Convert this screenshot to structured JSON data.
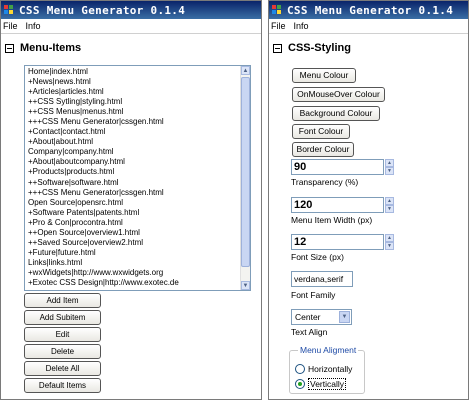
{
  "app_title": "CSS Menu Generator 0.1.4",
  "menubar": [
    "File",
    "Info"
  ],
  "left_panel": {
    "section_title": "Menu-Items",
    "items": [
      "Home|index.html",
      "+News|news.html",
      "+Articles|articles.html",
      "++CSS Sytling|styling.html",
      "++CSS Menus|menus.html",
      "+++CSS Menu Generator|cssgen.html",
      "+Contact|contact.html",
      "+About|about.html",
      "Company|company.html",
      "+About|aboutcompany.html",
      "+Products|products.html",
      "++Software|software.html",
      "+++CSS Menu Generator|cssgen.html",
      "Open Source|opensrc.html",
      "+Software Patents|patents.html",
      "+Pro & Con|procontra.html",
      "++Open Source|overview1.html",
      "++Saved Source|overview2.html",
      "+Future|future.html",
      "Links|links.html",
      "+wxWidgets|http://www.wxwidgets.org",
      "+Exotec CSS Design|http://www.exotec.de"
    ],
    "buttons": [
      "Add Item",
      "Add Subitem",
      "Edit",
      "Delete",
      "Delete All",
      "Default Items"
    ]
  },
  "right_panel": {
    "section_title": "CSS-Styling",
    "color_buttons": [
      "Menu Colour",
      "OnMouseOver Colour",
      "Background Colour",
      "Font Colour",
      "Border Colour"
    ],
    "transparency": {
      "value": "90",
      "label": "Transparency (%)"
    },
    "item_width": {
      "value": "120",
      "label": "Menu Item Width (px)"
    },
    "font_size": {
      "value": "12",
      "label": "Font Size (px)"
    },
    "font_family": {
      "value": "verdana,serif",
      "label": "Font Family"
    },
    "text_align": {
      "value": "Center",
      "label": "Text Align"
    },
    "alignment": {
      "legend": "Menu Aligment",
      "options": [
        "Horizontally",
        "Vertically"
      ],
      "selected": "Vertically"
    }
  },
  "colors": {
    "titlebar": "#0a246a",
    "accent": "#1f4ba6",
    "selected_radio": "#21a121"
  }
}
